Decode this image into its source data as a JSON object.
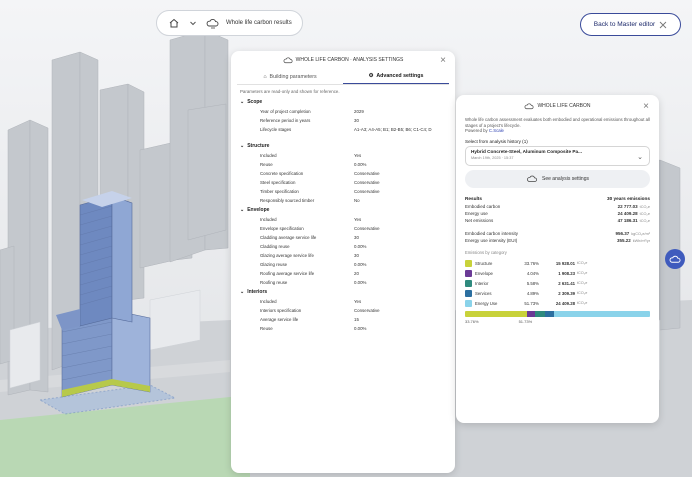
{
  "toolbar": {
    "title": "Whole life carbon results",
    "master_button_label": "Back to Master editor"
  },
  "settings_panel": {
    "header": "WHOLE LIFE CARBON · ANALYSIS SETTINGS",
    "tabs": [
      {
        "label": "Building parameters",
        "icon": "building-icon",
        "active": false
      },
      {
        "label": "Advanced settings",
        "icon": "gear-icon",
        "active": true
      }
    ],
    "note": "Parameters are read-only and shown for reference.",
    "sections": [
      {
        "title": "Scope",
        "rows": [
          {
            "k": "Year of project completion",
            "v": "2029"
          },
          {
            "k": "Reference period in years",
            "v": "30"
          },
          {
            "k": "Lifecycle stages",
            "v": "A1-A3; A4-A5; B1; B2-B5; B6; C1-C4; D"
          }
        ]
      },
      {
        "title": "Structure",
        "rows": [
          {
            "k": "Included",
            "v": "Yes"
          },
          {
            "k": "Reuse",
            "v": "0.00%"
          },
          {
            "k": "Concrete specification",
            "v": "Conservative"
          },
          {
            "k": "Steel specification",
            "v": "Conservative"
          },
          {
            "k": "Timber specification",
            "v": "Conservative"
          },
          {
            "k": "Responsibly sourced timber",
            "v": "No"
          }
        ]
      },
      {
        "title": "Envelope",
        "rows": [
          {
            "k": "Included",
            "v": "Yes"
          },
          {
            "k": "Envelope specification",
            "v": "Conservative"
          },
          {
            "k": "Cladding average service life",
            "v": "30"
          },
          {
            "k": "Cladding reuse",
            "v": "0.00%"
          },
          {
            "k": "Glazing average service life",
            "v": "30"
          },
          {
            "k": "Glazing reuse",
            "v": "0.00%"
          },
          {
            "k": "Roofing average service life",
            "v": "20"
          },
          {
            "k": "Roofing reuse",
            "v": "0.00%"
          }
        ]
      },
      {
        "title": "Interiors",
        "rows": [
          {
            "k": "Included",
            "v": "Yes"
          },
          {
            "k": "Interiors specification",
            "v": "Conservative"
          },
          {
            "k": "Average service life",
            "v": "15"
          },
          {
            "k": "Reuse",
            "v": "0.00%"
          }
        ]
      }
    ]
  },
  "carbon_panel": {
    "header": "WHOLE LIFE CARBON",
    "description": "Whole life carbon assessment evaluates both embodied and operational emissions throughout all stages of a project's lifecycle.",
    "powered_prefix": "Powered by",
    "powered_brand": "C.Scale",
    "history_label": "Select from analysis history (1)",
    "selected_title": "Hybrid Concrete-Steel, Aluminum Composite Pa...",
    "selected_date": "March 19th, 2025 · 15:37",
    "see_settings_label": "See analysis settings",
    "results_label": "Results",
    "results_period": "30 years emissions",
    "results": [
      {
        "k": "Embodied carbon",
        "v": "22 777.03",
        "u": "tCO₂e"
      },
      {
        "k": "Energy use",
        "v": "24 409.28",
        "u": "tCO₂e"
      },
      {
        "k": "Net emissions",
        "v": "47 186.31",
        "u": "tCO₂e"
      }
    ],
    "intensities": [
      {
        "k": "Embodied carbon intensity",
        "v": "956.37",
        "u": "kgCO₂e/m²"
      },
      {
        "k": "Energy use intensity (EUI)",
        "v": "355.22",
        "u": "kWh/m²/yr"
      }
    ],
    "category_title": "Emissions by category",
    "categories": [
      {
        "name": "Structure",
        "pct": "33.76%",
        "val": "15 928.01",
        "u": "tCO₂e",
        "color": "#c8d23a",
        "share": 33.76
      },
      {
        "name": "Envelope",
        "pct": "4.04%",
        "val": "1 908.23",
        "u": "tCO₂e",
        "color": "#6b3a96",
        "share": 4.04
      },
      {
        "name": "Interior",
        "pct": "5.58%",
        "val": "2 631.41",
        "u": "tCO₂e",
        "color": "#2f8a7e",
        "share": 5.58
      },
      {
        "name": "Services",
        "pct": "4.89%",
        "val": "2 309.39",
        "u": "tCO₂e",
        "color": "#2c6fa0",
        "share": 4.89
      },
      {
        "name": "Energy Use",
        "pct": "51.73%",
        "val": "24 409.28",
        "u": "tCO₂e",
        "color": "#8ad3ea",
        "share": 51.73
      }
    ],
    "bar_labels": [
      "33.76%",
      "51.73%"
    ]
  }
}
